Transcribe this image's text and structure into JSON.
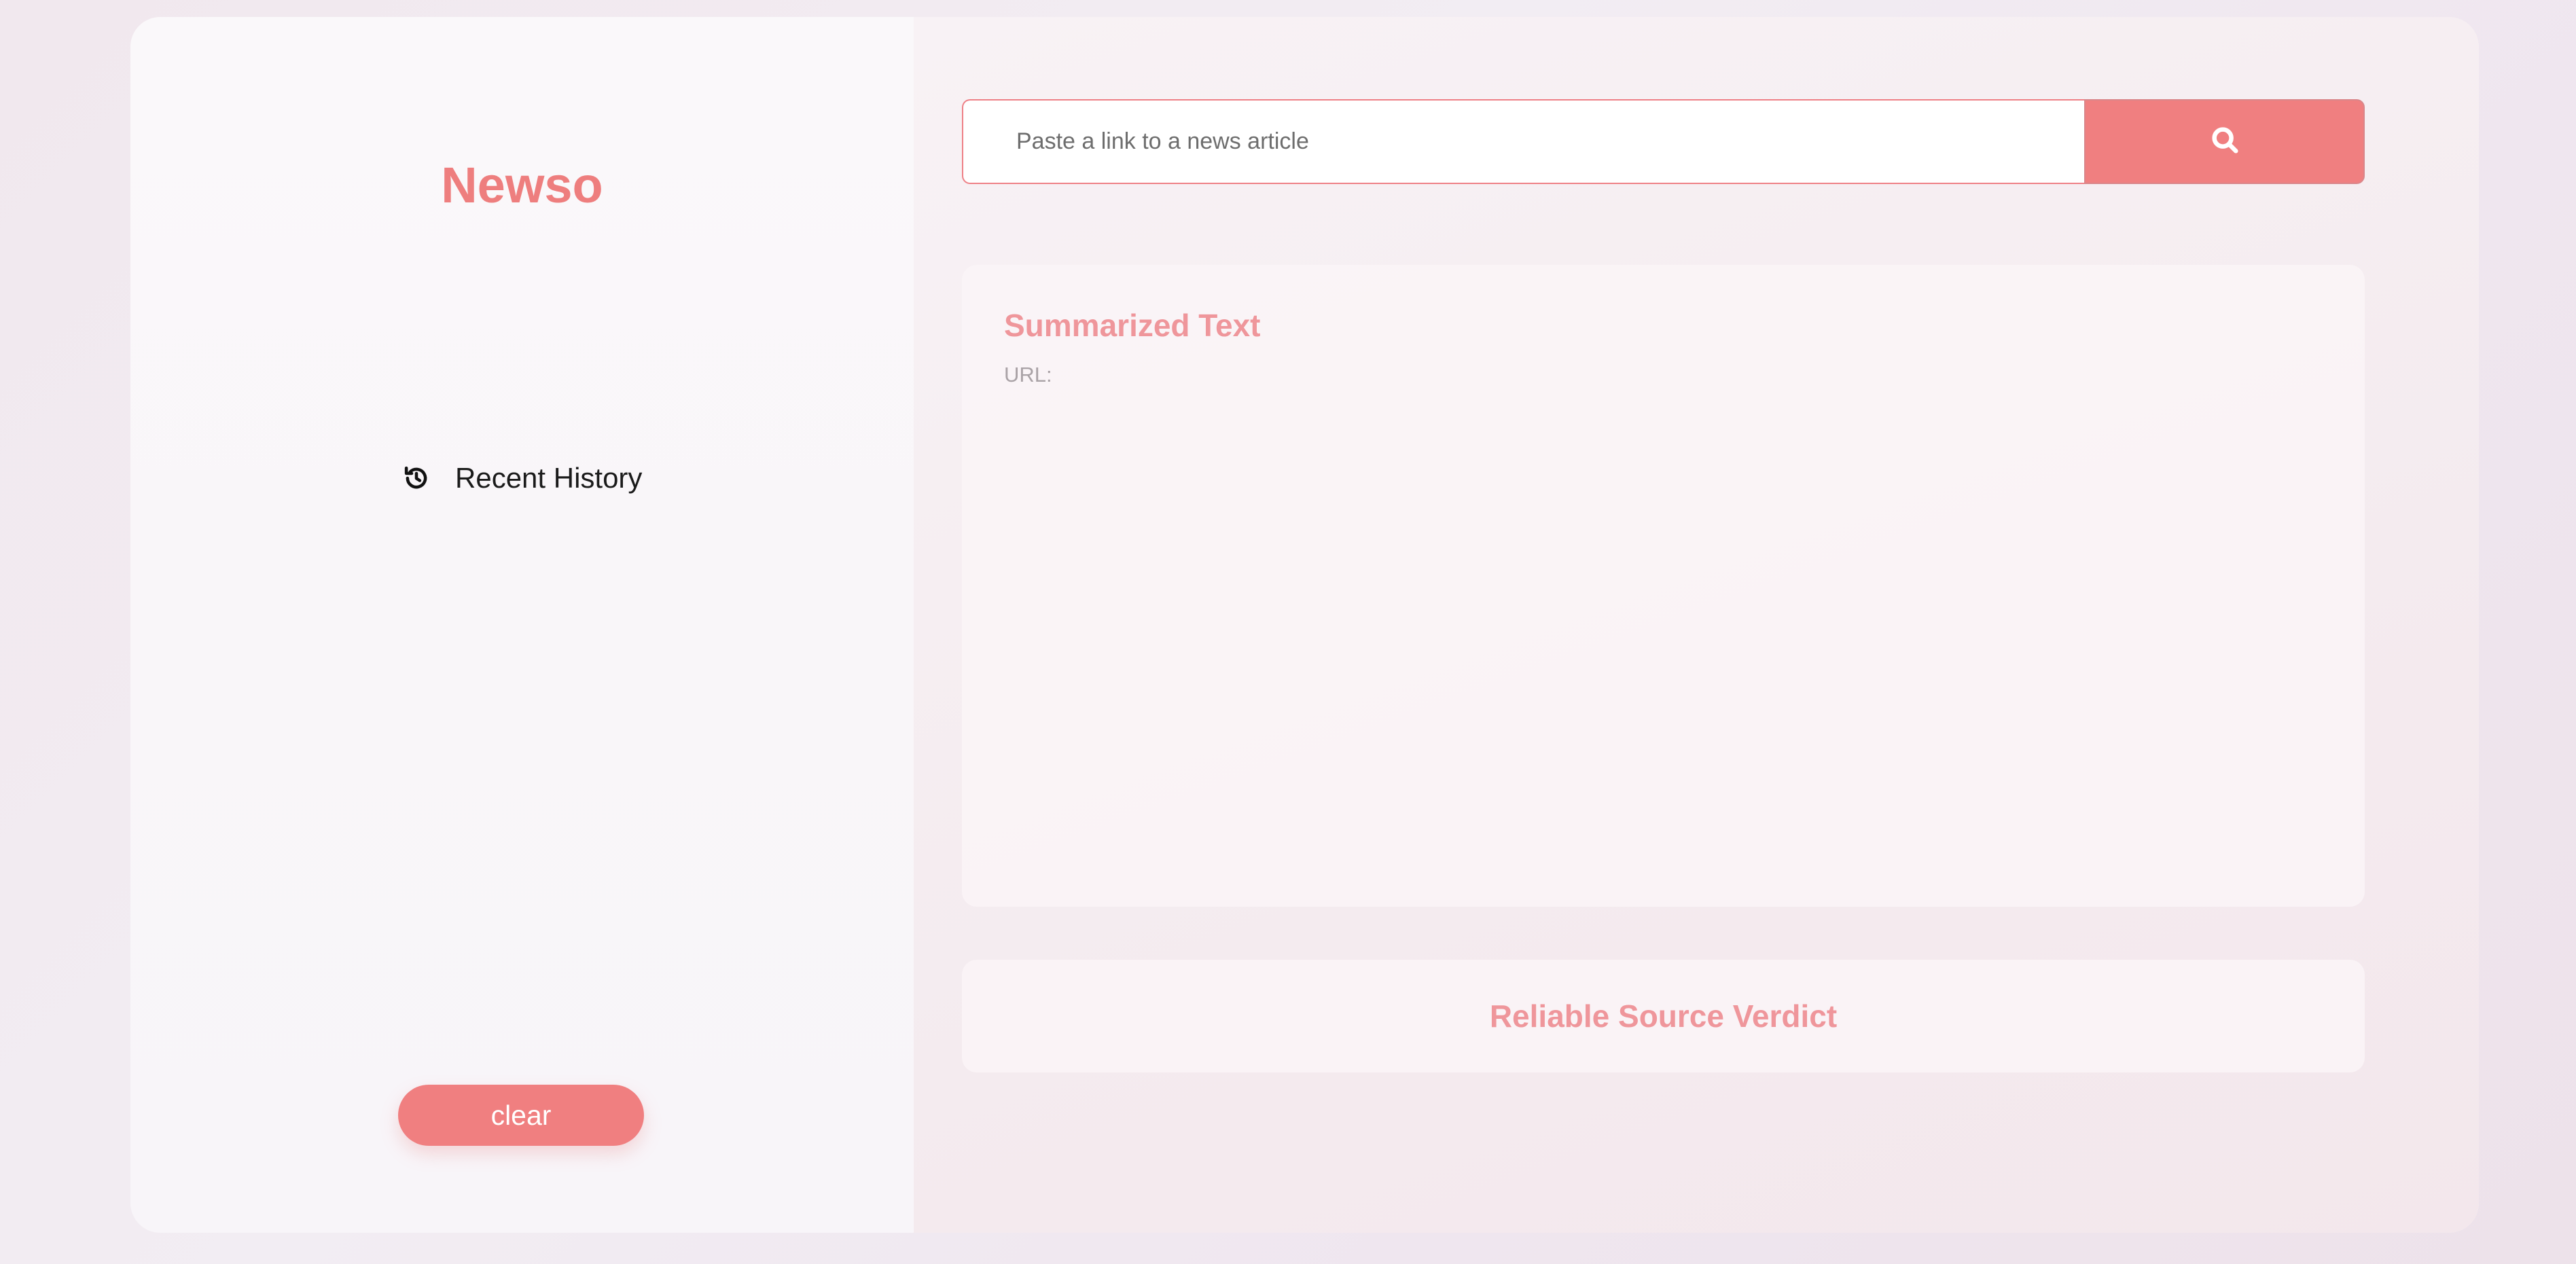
{
  "app": {
    "brand": "Newso"
  },
  "sidebar": {
    "history_label": "Recent History",
    "history_icon": "history-icon",
    "clear_label": "clear"
  },
  "search": {
    "placeholder": "Paste a link to a news article",
    "value": "",
    "button_icon": "search-icon"
  },
  "summary": {
    "title": "Summarized Text",
    "url_label": "URL:"
  },
  "verdict": {
    "title": "Reliable Source Verdict"
  },
  "colors": {
    "accent": "#f07f80",
    "title_pink": "#ef969b",
    "brand": "#ee7e7e"
  }
}
